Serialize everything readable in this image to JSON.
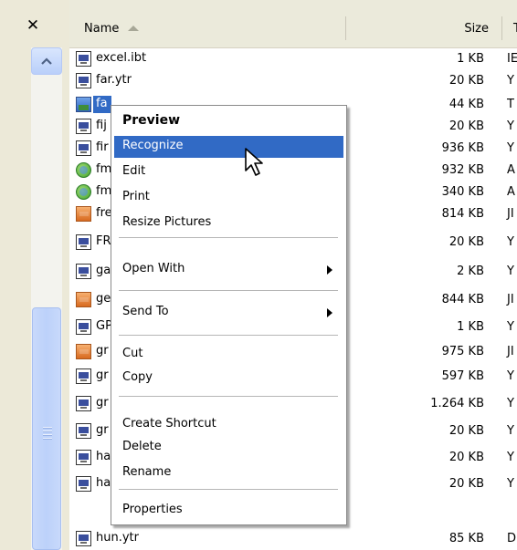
{
  "left_panel": {
    "close_glyph": "✕"
  },
  "header": {
    "name_col": "Name",
    "size_col": "Size",
    "type_col": "T"
  },
  "rows": [
    {
      "name": "excel.ibt",
      "size": "1 KB",
      "type": "IE",
      "icon": "doc-icon"
    },
    {
      "name": "far.ytr",
      "size": "20 KB",
      "type": "Y",
      "icon": "doc-icon"
    },
    {
      "name": "fa",
      "size": "44 KB",
      "type": "T",
      "icon": "image-icon"
    },
    {
      "name": "fij",
      "size": "20 KB",
      "type": "Y",
      "icon": "doc-icon"
    },
    {
      "name": "fir",
      "size": "936 KB",
      "type": "Y",
      "icon": "doc-icon"
    },
    {
      "name": "fm",
      "size": "932 KB",
      "type": "A",
      "icon": "green-icon"
    },
    {
      "name": "fm",
      "size": "340 KB",
      "type": "A",
      "icon": "green-icon"
    },
    {
      "name": "fre",
      "size": "814 KB",
      "type": "JI",
      "icon": "orange-icon"
    },
    {
      "name": "FR",
      "size": "20 KB",
      "type": "Y",
      "icon": "doc-icon"
    },
    {
      "name": "ga",
      "size": "2 KB",
      "type": "Y",
      "icon": "doc-icon"
    },
    {
      "name": "ge",
      "size": "844 KB",
      "type": "JI",
      "icon": "orange-icon"
    },
    {
      "name": "GP",
      "size": "1 KB",
      "type": "Y",
      "icon": "doc-icon"
    },
    {
      "name": "gr",
      "size": "975 KB",
      "type": "JI",
      "icon": "orange-icon"
    },
    {
      "name": "gr",
      "size": "597 KB",
      "type": "Y",
      "icon": "doc-icon"
    },
    {
      "name": "gr",
      "size": "1.264 KB",
      "type": "Y",
      "icon": "doc-icon"
    },
    {
      "name": "gr",
      "size": "20 KB",
      "type": "Y",
      "icon": "doc-icon"
    },
    {
      "name": "ha",
      "size": "20 KB",
      "type": "Y",
      "icon": "doc-icon"
    },
    {
      "name": "ha",
      "size": "20 KB",
      "type": "Y",
      "icon": "doc-icon"
    },
    {
      "name": "hun.ytr",
      "size": "85 KB",
      "type": "D",
      "icon": "doc-icon"
    }
  ],
  "context_menu": {
    "preview": "Preview",
    "recognize": "Recognize",
    "edit": "Edit",
    "print": "Print",
    "resize_pictures": "Resize Pictures",
    "open_with": "Open With",
    "send_to": "Send To",
    "cut": "Cut",
    "copy": "Copy",
    "create_shortcut": "Create Shortcut",
    "delete": "Delete",
    "rename": "Rename",
    "properties": "Properties"
  },
  "colors": {
    "selection": "#316ac5",
    "panel": "#ece9d8"
  }
}
